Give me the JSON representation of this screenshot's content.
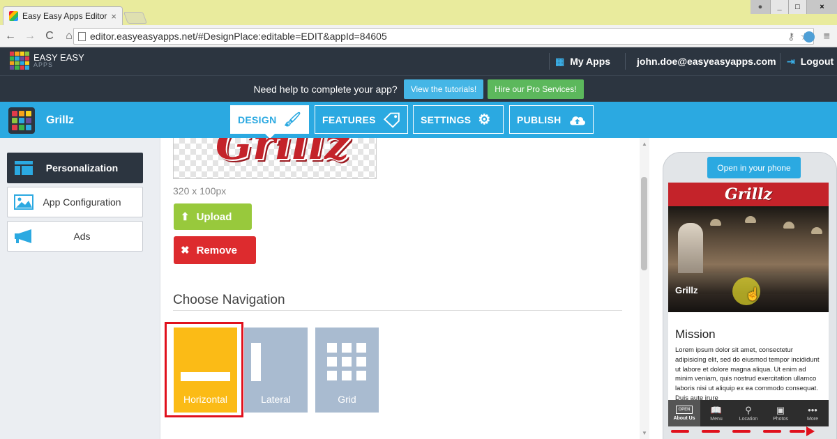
{
  "browser": {
    "tab_title": "Easy Easy Apps Editor",
    "tab_close": "×",
    "url": "editor.easyeasyapps.net/#DesignPlace:editable=EDIT&appId=84605",
    "back_icon": "←",
    "forward_icon": "→",
    "reload_icon": "C",
    "home_icon": "⌂",
    "menu_icon": "≡"
  },
  "header": {
    "logo_line1": "EASY EASY",
    "logo_line2": "APPS",
    "my_apps": "My Apps",
    "user_email": "john.doe@easyeasyapps.com",
    "logout": "Logout"
  },
  "help_bar": {
    "text": "Need help to complete your app?",
    "tutorials_button": "View the tutorials!",
    "pro_button": "Hire our Pro Services!"
  },
  "app": {
    "name": "Grillz"
  },
  "main_tabs": [
    {
      "label": "DESIGN",
      "icon": "brush-icon"
    },
    {
      "label": "FEATURES",
      "icon": "tag-icon"
    },
    {
      "label": "SETTINGS",
      "icon": "gear-icon"
    },
    {
      "label": "PUBLISH",
      "icon": "cloud-upload-icon"
    }
  ],
  "sidebar": {
    "items": [
      {
        "label": "Personalization",
        "active": true
      },
      {
        "label": "App Configuration",
        "active": false
      },
      {
        "label": "Ads",
        "active": false
      }
    ]
  },
  "editor": {
    "logo_text": "Grillz",
    "logo_dimensions": "320 x 100px",
    "upload_button": "Upload",
    "remove_button": "Remove",
    "navigation_title": "Choose Navigation",
    "navigation_options": [
      {
        "label": "Horizontal",
        "selected": true
      },
      {
        "label": "Lateral",
        "selected": false
      },
      {
        "label": "Grid",
        "selected": false
      }
    ]
  },
  "preview": {
    "open_phone_button": "Open in your phone",
    "app_logo": "Grillz",
    "photo_caption": "Grillz",
    "mission_title": "Mission",
    "mission_text": "Lorem ipsum dolor sit amet, consectetur adipisicing elit, sed do eiusmod tempor incididunt ut labore et dolore magna aliqua. Ut enim ad minim veniam, quis nostrud exercitation ullamco laboris nisi ut aliquip ex ea commodo consequat. Duis aute irure",
    "tabbar": [
      {
        "label": "About Us",
        "icon": "OPEN",
        "active": true
      },
      {
        "label": "Menu",
        "icon": "book-icon",
        "active": false
      },
      {
        "label": "Location",
        "icon": "pin-icon",
        "active": false
      },
      {
        "label": "Photos",
        "icon": "photo-icon",
        "active": false
      },
      {
        "label": "More",
        "icon": "dots-icon",
        "active": false
      }
    ]
  },
  "colors": {
    "header_dark": "#2c3540",
    "accent_blue": "#2ba9e1",
    "selected_yellow": "#fbbb16",
    "option_grey": "#a9bbd0",
    "upload_green": "#98c93c",
    "remove_red": "#dd2b2e",
    "highlight_red": "#e0101c"
  }
}
